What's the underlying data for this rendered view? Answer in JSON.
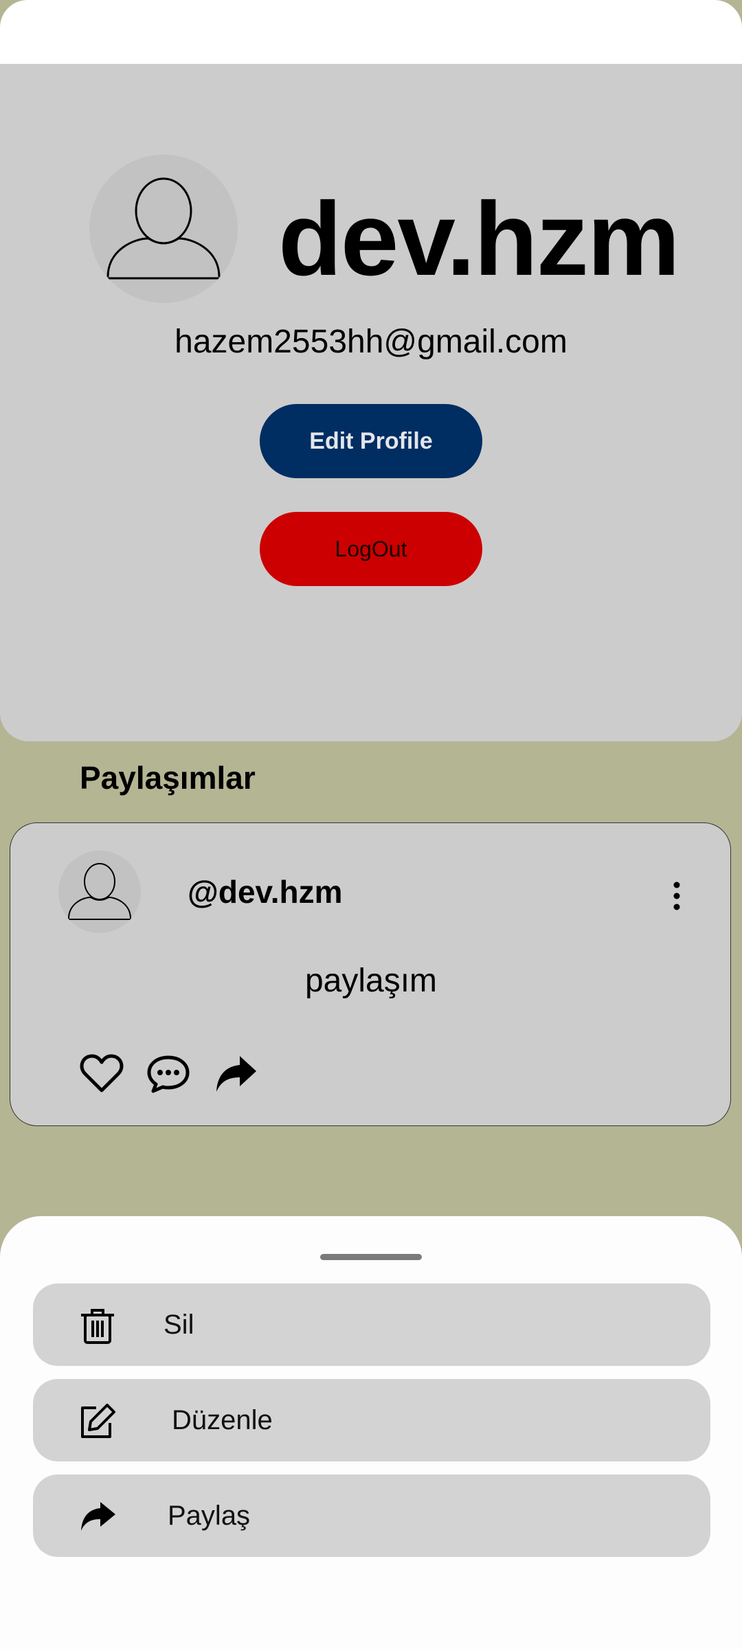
{
  "profile": {
    "username": "dev.hzm",
    "email": "hazem2553hh@gmail.com",
    "edit_button": "Edit Profile",
    "logout_button": "LogOut",
    "avatar_icon": "user-avatar-icon"
  },
  "posts": {
    "section_title": "Paylaşımlar",
    "items": [
      {
        "user": "@dev.hzm",
        "text": "paylaşım",
        "actions": [
          "heart-icon",
          "comment-icon",
          "share-icon"
        ]
      }
    ]
  },
  "sheet": {
    "items": [
      {
        "label": "Sil",
        "icon": "trash-icon"
      },
      {
        "label": "Düzenle",
        "icon": "edit-icon"
      },
      {
        "label": "Paylaş",
        "icon": "share-icon"
      }
    ]
  },
  "colors": {
    "background": "#b4b593",
    "card": "#cccccc",
    "edit_button": "#002d62",
    "logout_button": "#cc0000",
    "sheet_item": "#d3d3d3"
  }
}
